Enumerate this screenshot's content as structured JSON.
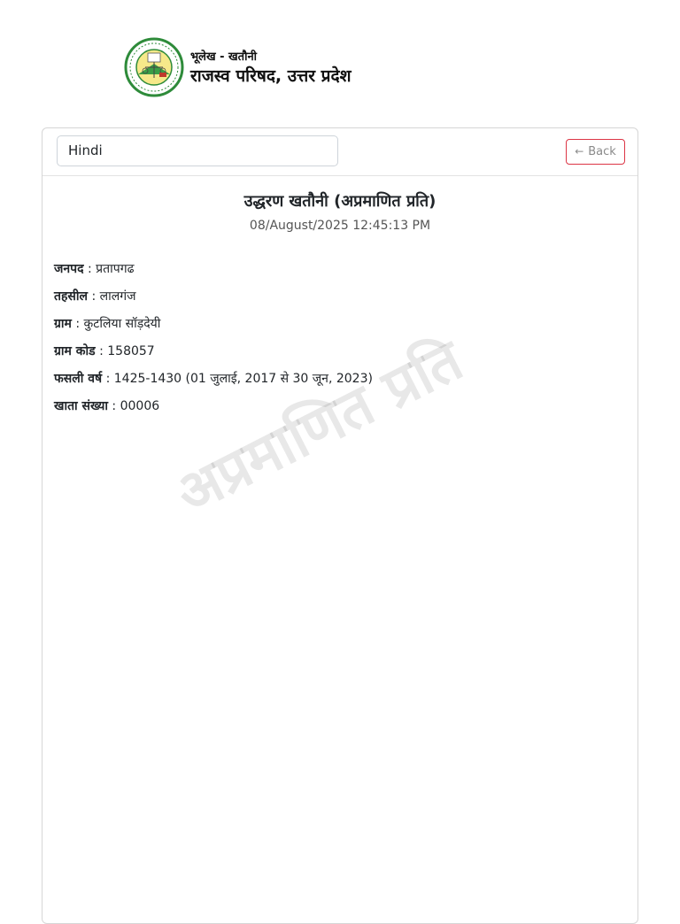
{
  "header": {
    "subtitle": "भूलेख - खतौनी",
    "title": "राजस्व परिषद, उत्तर प्रदेश",
    "logo_icon": "emblem-logo-icon"
  },
  "toolbar": {
    "language_value": "Hindi",
    "back_label": "Back",
    "back_icon": "arrow-left-icon"
  },
  "document": {
    "title": "उद्धरण खतौनी (अप्रमाणित प्रति)",
    "datetime": "08/August/2025 12:45:13 PM",
    "watermark": "अप्रमाणित प्रति",
    "fields": [
      {
        "label": "जनपद",
        "value": "प्रतापगढ"
      },
      {
        "label": "तहसील",
        "value": "लालगंज"
      },
      {
        "label": "ग्राम",
        "value": "कुटलिया सॉड़देयी"
      },
      {
        "label": "ग्राम कोड",
        "value": "158057"
      },
      {
        "label": "फसली वर्ष",
        "value": "1425-1430 (01 जुलाई, 2017 से 30 जून, 2023)"
      },
      {
        "label": "खाता संख्या",
        "value": "00006"
      }
    ]
  },
  "colors": {
    "back_border": "#dc3545",
    "logo_green": "#2e8b3a",
    "logo_yellow": "#e9d44a"
  }
}
